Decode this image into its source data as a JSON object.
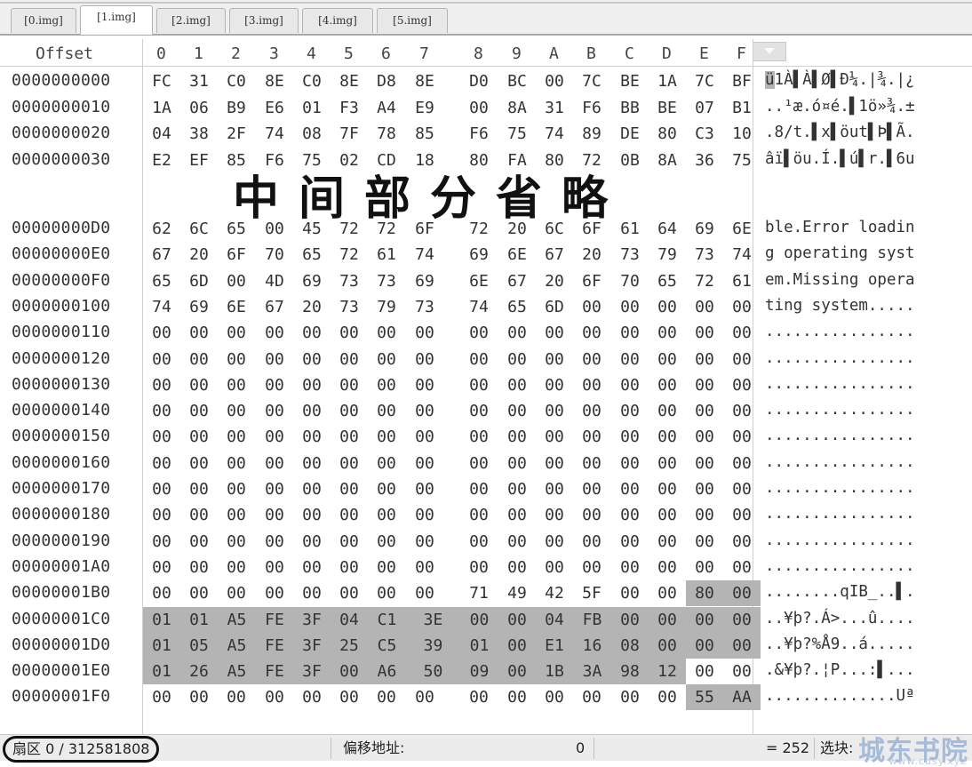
{
  "tabs": [
    {
      "label": "[0.img]",
      "active": false
    },
    {
      "label": "[1.img]",
      "active": true
    },
    {
      "label": "[2.img]",
      "active": false
    },
    {
      "label": "[3.img]",
      "active": false
    },
    {
      "label": "[4.img]",
      "active": false
    },
    {
      "label": "[5.img]",
      "active": false
    }
  ],
  "header": {
    "offset_label": "Offset",
    "columns": [
      "0",
      "1",
      "2",
      "3",
      "4",
      "5",
      "6",
      "7",
      "8",
      "9",
      "A",
      "B",
      "C",
      "D",
      "E",
      "F"
    ]
  },
  "omitted_banner": "中间部分省略",
  "rows_top": [
    {
      "offset": "0000000000",
      "bytes": [
        "FC",
        "31",
        "C0",
        "8E",
        "C0",
        "8E",
        "D8",
        "8E",
        "D0",
        "BC",
        "00",
        "7C",
        "BE",
        "1A",
        "7C",
        "BF"
      ],
      "ascii": "ü1À▌À▌Ø▌Ð¼.|¾.|¿"
    },
    {
      "offset": "0000000010",
      "bytes": [
        "1A",
        "06",
        "B9",
        "E6",
        "01",
        "F3",
        "A4",
        "E9",
        "00",
        "8A",
        "31",
        "F6",
        "BB",
        "BE",
        "07",
        "B1"
      ],
      "ascii": "..¹æ.ó¤é.▌1ö»¾.±"
    },
    {
      "offset": "0000000020",
      "bytes": [
        "04",
        "38",
        "2F",
        "74",
        "08",
        "7F",
        "78",
        "85",
        "F6",
        "75",
        "74",
        "89",
        "DE",
        "80",
        "C3",
        "10"
      ],
      "ascii": ".8/t.▌x▌öut▌Þ▌Ã."
    },
    {
      "offset": "0000000030",
      "bytes": [
        "E2",
        "EF",
        "85",
        "F6",
        "75",
        "02",
        "CD",
        "18",
        "80",
        "FA",
        "80",
        "72",
        "0B",
        "8A",
        "36",
        "75"
      ],
      "ascii": "âï▌öu.Í.▌ú▌r.▌6u"
    }
  ],
  "rows_bottom": [
    {
      "offset": "00000000D0",
      "bytes": [
        "62",
        "6C",
        "65",
        "00",
        "45",
        "72",
        "72",
        "6F",
        "72",
        "20",
        "6C",
        "6F",
        "61",
        "64",
        "69",
        "6E"
      ],
      "ascii": "ble.Error loadin"
    },
    {
      "offset": "00000000E0",
      "bytes": [
        "67",
        "20",
        "6F",
        "70",
        "65",
        "72",
        "61",
        "74",
        "69",
        "6E",
        "67",
        "20",
        "73",
        "79",
        "73",
        "74"
      ],
      "ascii": "g operating syst"
    },
    {
      "offset": "00000000F0",
      "bytes": [
        "65",
        "6D",
        "00",
        "4D",
        "69",
        "73",
        "73",
        "69",
        "6E",
        "67",
        "20",
        "6F",
        "70",
        "65",
        "72",
        "61"
      ],
      "ascii": "em.Missing opera"
    },
    {
      "offset": "0000000100",
      "bytes": [
        "74",
        "69",
        "6E",
        "67",
        "20",
        "73",
        "79",
        "73",
        "74",
        "65",
        "6D",
        "00",
        "00",
        "00",
        "00",
        "00"
      ],
      "ascii": "ting system....."
    },
    {
      "offset": "0000000110",
      "bytes": [
        "00",
        "00",
        "00",
        "00",
        "00",
        "00",
        "00",
        "00",
        "00",
        "00",
        "00",
        "00",
        "00",
        "00",
        "00",
        "00"
      ],
      "ascii": "................"
    },
    {
      "offset": "0000000120",
      "bytes": [
        "00",
        "00",
        "00",
        "00",
        "00",
        "00",
        "00",
        "00",
        "00",
        "00",
        "00",
        "00",
        "00",
        "00",
        "00",
        "00"
      ],
      "ascii": "................"
    },
    {
      "offset": "0000000130",
      "bytes": [
        "00",
        "00",
        "00",
        "00",
        "00",
        "00",
        "00",
        "00",
        "00",
        "00",
        "00",
        "00",
        "00",
        "00",
        "00",
        "00"
      ],
      "ascii": "................"
    },
    {
      "offset": "0000000140",
      "bytes": [
        "00",
        "00",
        "00",
        "00",
        "00",
        "00",
        "00",
        "00",
        "00",
        "00",
        "00",
        "00",
        "00",
        "00",
        "00",
        "00"
      ],
      "ascii": "................"
    },
    {
      "offset": "0000000150",
      "bytes": [
        "00",
        "00",
        "00",
        "00",
        "00",
        "00",
        "00",
        "00",
        "00",
        "00",
        "00",
        "00",
        "00",
        "00",
        "00",
        "00"
      ],
      "ascii": "................"
    },
    {
      "offset": "0000000160",
      "bytes": [
        "00",
        "00",
        "00",
        "00",
        "00",
        "00",
        "00",
        "00",
        "00",
        "00",
        "00",
        "00",
        "00",
        "00",
        "00",
        "00"
      ],
      "ascii": "................"
    },
    {
      "offset": "0000000170",
      "bytes": [
        "00",
        "00",
        "00",
        "00",
        "00",
        "00",
        "00",
        "00",
        "00",
        "00",
        "00",
        "00",
        "00",
        "00",
        "00",
        "00"
      ],
      "ascii": "................"
    },
    {
      "offset": "0000000180",
      "bytes": [
        "00",
        "00",
        "00",
        "00",
        "00",
        "00",
        "00",
        "00",
        "00",
        "00",
        "00",
        "00",
        "00",
        "00",
        "00",
        "00"
      ],
      "ascii": "................"
    },
    {
      "offset": "0000000190",
      "bytes": [
        "00",
        "00",
        "00",
        "00",
        "00",
        "00",
        "00",
        "00",
        "00",
        "00",
        "00",
        "00",
        "00",
        "00",
        "00",
        "00"
      ],
      "ascii": "................"
    },
    {
      "offset": "00000001A0",
      "bytes": [
        "00",
        "00",
        "00",
        "00",
        "00",
        "00",
        "00",
        "00",
        "00",
        "00",
        "00",
        "00",
        "00",
        "00",
        "00",
        "00"
      ],
      "ascii": "................"
    },
    {
      "offset": "00000001B0",
      "bytes": [
        "00",
        "00",
        "00",
        "00",
        "00",
        "00",
        "00",
        "00",
        "71",
        "49",
        "42",
        "5F",
        "00",
        "00",
        "80",
        "00"
      ],
      "ascii": "........qIB_..▌.",
      "highlight": [
        14,
        15
      ]
    },
    {
      "offset": "00000001C0",
      "bytes": [
        "01",
        "01",
        "A5",
        "FE",
        "3F",
        "04",
        "C1",
        "3E",
        "00",
        "00",
        "04",
        "FB",
        "00",
        "00",
        "00",
        "00"
      ],
      "ascii": "..¥þ?.Á>...û....",
      "highlight": [
        0,
        1,
        2,
        3,
        4,
        5,
        6,
        7,
        8,
        9,
        10,
        11,
        12,
        13,
        14,
        15
      ]
    },
    {
      "offset": "00000001D0",
      "bytes": [
        "01",
        "05",
        "A5",
        "FE",
        "3F",
        "25",
        "C5",
        "39",
        "01",
        "00",
        "E1",
        "16",
        "08",
        "00",
        "00",
        "00"
      ],
      "ascii": "..¥þ?%Å9..á.....",
      "highlight": [
        0,
        1,
        2,
        3,
        4,
        5,
        6,
        7,
        8,
        9,
        10,
        11,
        12,
        13,
        14,
        15
      ]
    },
    {
      "offset": "00000001E0",
      "bytes": [
        "01",
        "26",
        "A5",
        "FE",
        "3F",
        "00",
        "A6",
        "50",
        "09",
        "00",
        "1B",
        "3A",
        "98",
        "12",
        "00",
        "00"
      ],
      "ascii": ".&¥þ?.¦P...:▌...",
      "highlight": [
        0,
        1,
        2,
        3,
        4,
        5,
        6,
        7,
        8,
        9,
        10,
        11,
        12,
        13
      ]
    },
    {
      "offset": "00000001F0",
      "bytes": [
        "00",
        "00",
        "00",
        "00",
        "00",
        "00",
        "00",
        "00",
        "00",
        "00",
        "00",
        "00",
        "00",
        "00",
        "55",
        "AA"
      ],
      "ascii": "..............Uª",
      "highlight": [
        14,
        15
      ]
    }
  ],
  "status": {
    "sector": "扇区 0 / 312581808",
    "offset_label": "偏移地址:",
    "offset_value": "0",
    "value": "= 252",
    "block_label": "选块:"
  },
  "watermark": {
    "title": "城东书院",
    "url": "www.cdsy.xyz"
  },
  "colors": {
    "selection": "#b4b4b4",
    "tab_active": "#ffffff",
    "status_bg": "#ececec"
  }
}
